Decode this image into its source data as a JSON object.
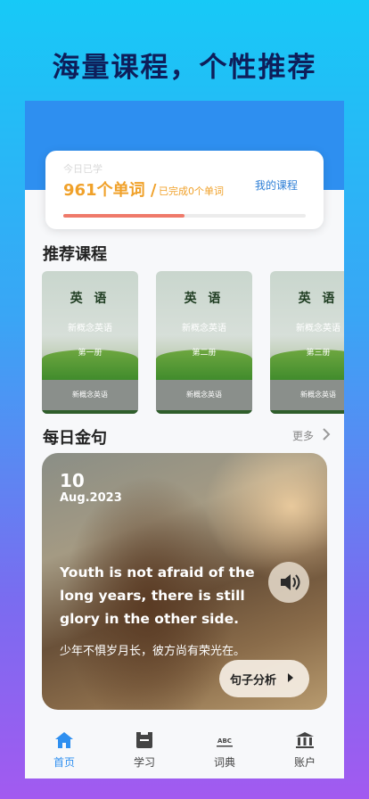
{
  "promo": {
    "title": "海量课程，个性推荐"
  },
  "progress_card": {
    "faded_label": "今日已学",
    "word_count": "961个单词 /",
    "completed": "已完成0个单词",
    "my_course": "我的课程",
    "progress": 0.5
  },
  "recommend": {
    "title": "推荐课程",
    "books": [
      {
        "title": "英 语",
        "subtitle": "新概念英语",
        "volume": "第一册",
        "footer": "新概念英语"
      },
      {
        "title": "英 语",
        "subtitle": "新概念英语",
        "volume": "第二册",
        "footer": "新概念英语"
      },
      {
        "title": "英 语",
        "subtitle": "新概念英语",
        "volume": "第三册",
        "footer": "新概念英语"
      }
    ]
  },
  "daily": {
    "title": "每日金句",
    "more": "更多",
    "day": "10",
    "month_year": "Aug.2023",
    "english": "Youth is not afraid of the long years, there is still glory in the other side.",
    "chinese": "少年不惧岁月长，彼方尚有荣光在。",
    "analyze": "句子分析"
  },
  "tabs": [
    {
      "label": "首页",
      "icon": "home-icon",
      "active": true
    },
    {
      "label": "学习",
      "icon": "study-icon",
      "active": false
    },
    {
      "label": "词典",
      "icon": "dictionary-icon",
      "active": false
    },
    {
      "label": "账户",
      "icon": "account-icon",
      "active": false
    }
  ],
  "colors": {
    "accent": "#f0a12a",
    "active_tab": "#2e8ff0",
    "progress": "#ef7a6a"
  }
}
